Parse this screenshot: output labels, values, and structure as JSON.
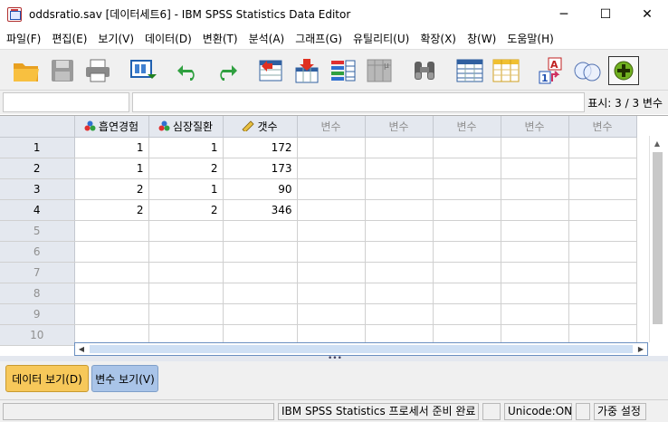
{
  "window": {
    "title": "oddsratio.sav [데이터세트6] - IBM SPSS Statistics Data Editor",
    "minimize_glyph": "─",
    "maximize_glyph": "☐",
    "close_glyph": "✕"
  },
  "menu": [
    "파일(F)",
    "편집(E)",
    "보기(V)",
    "데이터(D)",
    "변환(T)",
    "분석(A)",
    "그래프(G)",
    "유틸리티(U)",
    "확장(X)",
    "창(W)",
    "도움말(H)"
  ],
  "toolbar_icons": [
    "open-folder-icon",
    "save-icon",
    "print-icon",
    "dialog-recall-icon",
    "undo-icon",
    "redo-icon",
    "goto-case-icon",
    "goto-variable-icon",
    "variables-icon",
    "run-descriptives-icon",
    "find-icon",
    "insert-cases-icon",
    "insert-variable-icon",
    "value-labels-icon",
    "use-sets-icon",
    "customize-icon"
  ],
  "editbar": {
    "cell_ref": "",
    "cell_value": "",
    "display_count": "표시: 3 / 3 변수"
  },
  "grid": {
    "columns": [
      {
        "label": "흡연경험",
        "type": "nominal"
      },
      {
        "label": "심장질환",
        "type": "nominal"
      },
      {
        "label": "갯수",
        "type": "scale"
      },
      {
        "label": "변수",
        "type": "empty"
      },
      {
        "label": "변수",
        "type": "empty"
      },
      {
        "label": "변수",
        "type": "empty"
      },
      {
        "label": "변수",
        "type": "empty"
      },
      {
        "label": "변수",
        "type": "empty"
      }
    ],
    "rows": [
      {
        "num": "1",
        "cells": [
          "1",
          "1",
          "172"
        ]
      },
      {
        "num": "2",
        "cells": [
          "1",
          "2",
          "173"
        ]
      },
      {
        "num": "3",
        "cells": [
          "2",
          "1",
          "90"
        ]
      },
      {
        "num": "4",
        "cells": [
          "2",
          "2",
          "346"
        ]
      },
      {
        "num": "5",
        "cells": [
          "",
          "",
          ""
        ]
      },
      {
        "num": "6",
        "cells": [
          "",
          "",
          ""
        ]
      },
      {
        "num": "7",
        "cells": [
          "",
          "",
          ""
        ]
      },
      {
        "num": "8",
        "cells": [
          "",
          "",
          ""
        ]
      },
      {
        "num": "9",
        "cells": [
          "",
          "",
          ""
        ]
      },
      {
        "num": "10",
        "cells": [
          "",
          "",
          ""
        ]
      }
    ]
  },
  "tabs": {
    "data_view": "데이터 보기(D)",
    "variable_view": "변수 보기(V)"
  },
  "status": {
    "processor": "IBM SPSS Statistics 프로세서 준비 완료",
    "unicode": "Unicode:ON",
    "weight": "가중 설정"
  },
  "colors": {
    "header_bg": "#e4e8ef",
    "data_tab": "#f7c85a",
    "variable_tab": "#a9c4e8"
  }
}
